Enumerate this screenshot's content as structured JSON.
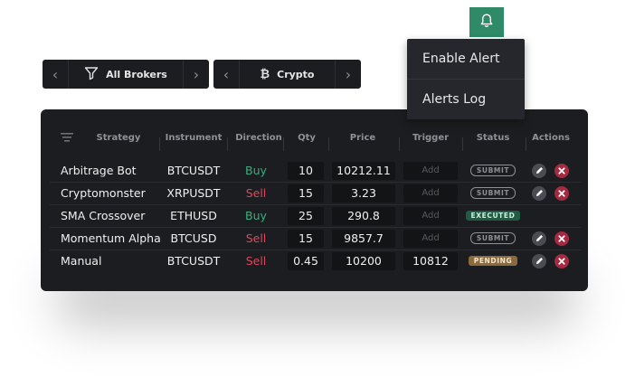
{
  "filters": [
    {
      "label": "All Brokers",
      "icon": "filter-icon"
    },
    {
      "label": "Crypto",
      "icon": "bitcoin-icon"
    }
  ],
  "nav": {
    "prev": "‹",
    "next": "›"
  },
  "alerts": {
    "bell_icon": "bell-icon",
    "menu": [
      "Enable Alert",
      "Alerts Log"
    ]
  },
  "table": {
    "headers": [
      "Strategy",
      "Instrument",
      "Direction",
      "Qty",
      "Price",
      "Trigger",
      "Status",
      "Actions"
    ],
    "trigger_placeholder": "Add",
    "rows": [
      {
        "strategy": "Arbitrage Bot",
        "instrument": "BTCUSDT",
        "direction": "Buy",
        "qty": "10",
        "price": "10212.11",
        "trigger": "",
        "status": "SUBMIT",
        "actions": true
      },
      {
        "strategy": "Cryptomonster",
        "instrument": "XRPUSDT",
        "direction": "Sell",
        "qty": "15",
        "price": "3.23",
        "trigger": "",
        "status": "SUBMIT",
        "actions": true
      },
      {
        "strategy": "SMA Crossover",
        "instrument": "ETHUSD",
        "direction": "Buy",
        "qty": "25",
        "price": "290.8",
        "trigger": "",
        "status": "EXECUTED",
        "actions": false
      },
      {
        "strategy": "Momentum Alpha",
        "instrument": "BTCUSD",
        "direction": "Sell",
        "qty": "15",
        "price": "9857.7",
        "trigger": "",
        "status": "SUBMIT",
        "actions": true
      },
      {
        "strategy": "Manual",
        "instrument": "BTCUSDT",
        "direction": "Sell",
        "qty": "0.45",
        "price": "10200",
        "trigger": "10812",
        "status": "PENDING",
        "actions": true
      }
    ]
  },
  "colors": {
    "buy": "#3cae7e",
    "sell": "#e0455c",
    "bell_bg": "#2f8a67",
    "executed": "#1f5c43",
    "pending": "#8b6a3d"
  }
}
